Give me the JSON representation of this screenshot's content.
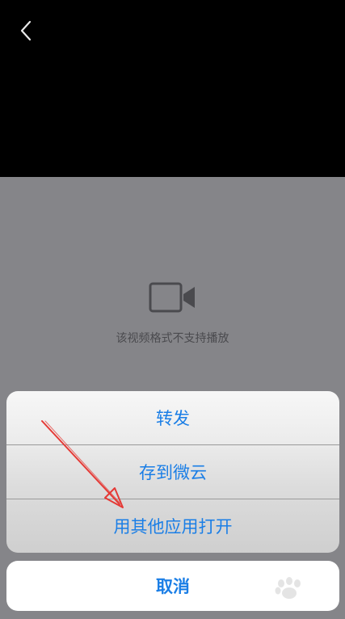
{
  "video": {
    "message": "该视频格式不支持播放"
  },
  "action_sheet": {
    "items": [
      {
        "label": "转发"
      },
      {
        "label": "存到微云"
      },
      {
        "label": "用其他应用打开"
      }
    ],
    "cancel_label": "取消"
  },
  "colors": {
    "accent": "#1a7ee6",
    "video_background": "#858589",
    "annotation_arrow": "#e53935"
  },
  "icons": {
    "back": "chevron-left-icon",
    "video": "video-camera-icon"
  }
}
